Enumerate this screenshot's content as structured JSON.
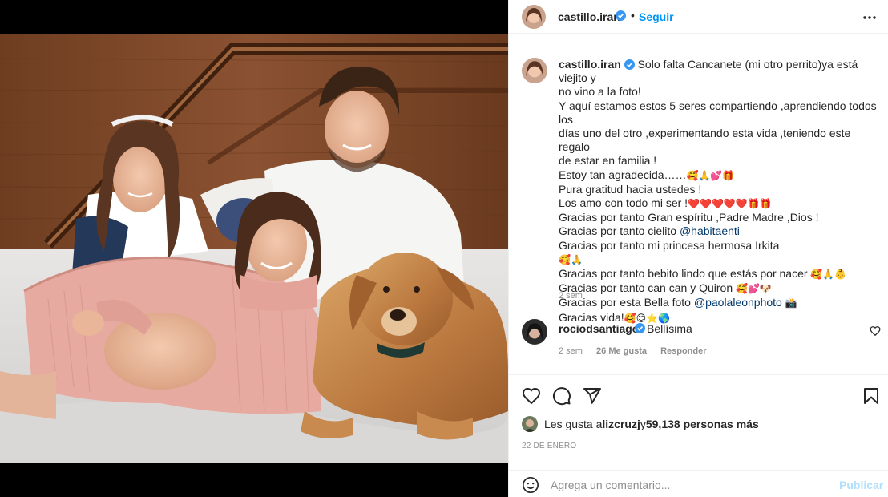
{
  "post": {
    "author": "castillo.iran",
    "follow_label": "Seguir",
    "dot": "•",
    "more_icon": "more-horizontal-icon",
    "verified_color": "#3897f0"
  },
  "caption": {
    "author": "castillo.iran",
    "lines": [
      "Solo falta Cancanete (mi otro perrito)ya está viejito y",
      "no vino a la foto!",
      "Y aquí estamos estos 5 seres compartiendo ,aprendiendo todos los",
      "días uno del otro ,experimentando esta vida ,teniendo este regalo",
      "de estar en familia !",
      "Estoy tan agradecida……",
      "Pura gratitud hacia ustedes !",
      "Los amo con todo mi ser !",
      "Gracias por tanto Gran espíritu ,Padre Madre ,Dios !",
      "Gracias por tanto cielito ",
      "Gracias por tanto mi princesa hermosa Irkita",
      "",
      "Gracias por tanto bebito lindo que estás por nacer ",
      "Gracias por tanto can can y Quiron ",
      "Gracias por esta Bella foto ",
      "Gracias vida!"
    ],
    "emoji": {
      "agradecida": "🥰🙏💕🎁",
      "amo": "❤️❤️❤️❤️❤️🎁🎁",
      "irkita": "🥰🙏",
      "bebito": "🥰🙏👶",
      "can": "🥰💕🐶",
      "foto": "📸",
      "vida": "🥰😊⭐🌎"
    },
    "mention_cielito": "@habitaenti",
    "mention_foto": "@paolaleonphoto",
    "time": "2 sem"
  },
  "comment": {
    "author": "rociodsantiago",
    "text": "Bellísima",
    "time": "2 sem",
    "likes": "26 Me gusta",
    "reply_label": "Responder"
  },
  "actions": {
    "like_icon": "heart-icon",
    "comment_icon": "comment-icon",
    "share_icon": "share-icon",
    "save_icon": "bookmark-icon"
  },
  "likes": {
    "prefix": "Les gusta a ",
    "user": "lizcruzj",
    "middle": " y ",
    "count": "59,138 personas más"
  },
  "date": "22 DE ENERO",
  "add_comment": {
    "placeholder": "Agrega un comentario...",
    "publish_label": "Publicar",
    "publish_color": "#b2dffc"
  }
}
